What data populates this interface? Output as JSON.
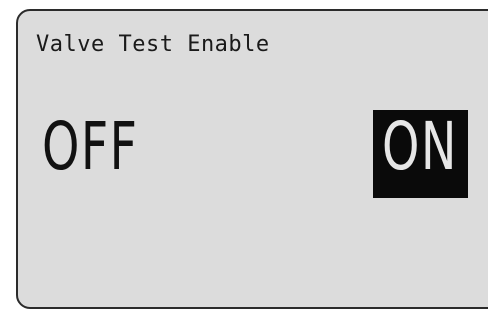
{
  "screen": {
    "title": "Valve Test Enable",
    "options": {
      "off_label": "OFF",
      "on_label": "ON",
      "selected": "ON"
    }
  },
  "colors": {
    "screen_bg": "#dcdcdc",
    "text": "#111111",
    "selected_bg": "#0a0a0a",
    "selected_text": "#e6e6e6"
  }
}
